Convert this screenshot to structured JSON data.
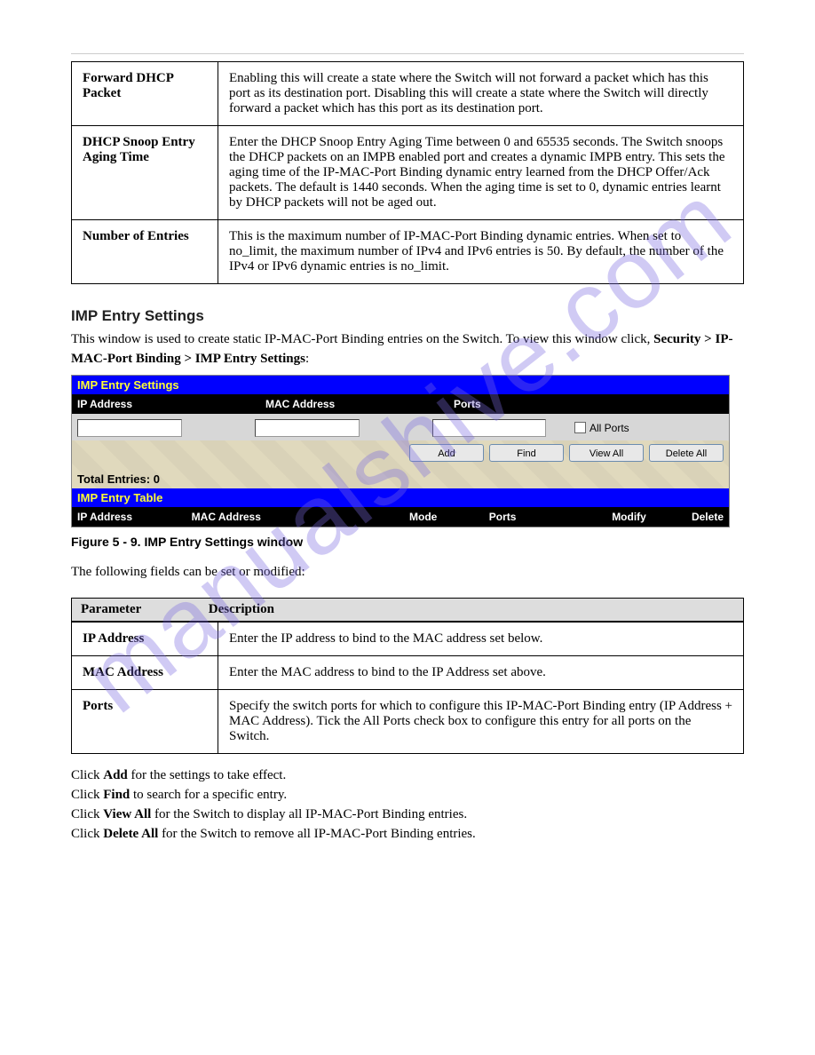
{
  "watermark": "manualshive.com",
  "defs1": [
    {
      "label": "Forward DHCP Packet",
      "text": "Enabling this will create a state where the Switch will not forward a packet which has this port as its destination port. Disabling this will create a state where the Switch will directly forward a packet which has this port as its destination port."
    },
    {
      "label": "DHCP Snoop Entry Aging Time",
      "text": "Enter the DHCP Snoop Entry Aging Time between 0 and 65535 seconds. The Switch snoops the DHCP packets on an IMPB enabled port and creates a dynamic IMPB entry. This sets the aging time of the IP-MAC-Port Binding dynamic entry learned from the DHCP Offer/Ack packets. The default is 1440 seconds. When the aging time is set to 0, dynamic entries learnt by DHCP packets will not be aged out."
    },
    {
      "label": "Number of Entries",
      "text": "This is the maximum number of IP-MAC-Port Binding dynamic entries. When set to no_limit, the maximum number of IPv4 and IPv6 entries is 50. By default, the number of the IPv4 or IPv6 dynamic entries is no_limit."
    }
  ],
  "section": {
    "imp_entry": {
      "title": "IMP Entry Settings",
      "intro": "This window is used to create static IP-MAC-Port Binding entries on the Switch. To view this window click, ",
      "path": "Security > IP-MAC-Port Binding > IMP Entry Settings",
      "colon": ":"
    }
  },
  "ui": {
    "title_settings": "IMP Entry Settings",
    "cols": {
      "ip": "IP Address",
      "mac": "MAC Address",
      "ports": "Ports"
    },
    "allports": "All Ports",
    "btns": {
      "add": "Add",
      "find": "Find",
      "viewall": "View All",
      "deleteall": "Delete All"
    },
    "total": "Total Entries: 0",
    "title_table": "IMP Entry Table",
    "tblcols": {
      "ip": "IP Address",
      "mac": "MAC Address",
      "mode": "Mode",
      "ports": "Ports",
      "modify": "Modify",
      "delete": "Delete"
    }
  },
  "figure_caption": "Figure 5 - 9. IMP Entry Settings window",
  "table2_intro": "The following fields can be set or modified:",
  "desc_headers": {
    "param": "Parameter",
    "desc": "Description"
  },
  "defs2": [
    {
      "label": "IP Address",
      "text": "Enter the IP address to bind to the MAC address set below."
    },
    {
      "label": "MAC Address",
      "text": "Enter the MAC address to bind to the IP Address set above."
    },
    {
      "label": "Ports",
      "text": "Specify the switch ports for which to configure this IP-MAC-Port Binding entry (IP Address + MAC Address). Tick the All Ports check box to configure this entry for all ports on the Switch."
    }
  ],
  "closing": [
    {
      "pre": "Click ",
      "b": "Add",
      "post": " for the settings to take effect."
    },
    {
      "pre": "Click ",
      "b": "Find",
      "post": " to search for a specific entry."
    },
    {
      "pre": "Click ",
      "b": "View All",
      "post": " for the Switch to display all IP-MAC-Port Binding entries."
    },
    {
      "pre": "Click ",
      "b": "Delete All",
      "post": " for the Switch to remove all IP-MAC-Port Binding entries."
    }
  ]
}
